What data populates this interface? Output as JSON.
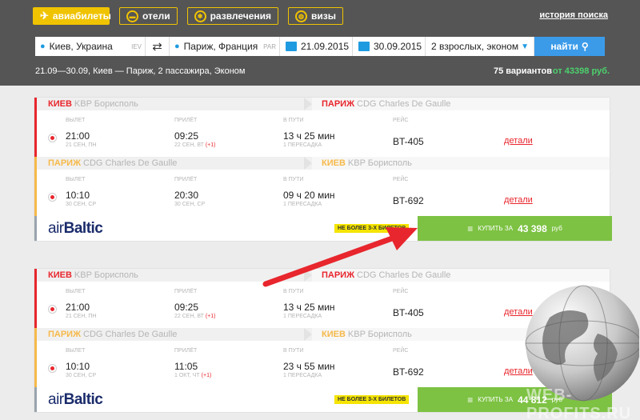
{
  "nav": {
    "flights": "авиабилеты",
    "hotels": "отели",
    "fun": "развлечения",
    "visas": "визы",
    "history": "история поиска"
  },
  "search": {
    "from": "Киев, Украина",
    "from_code": "IEV",
    "to": "Париж, Франция",
    "to_code": "PAR",
    "date_out": "21.09.2015",
    "date_back": "30.09.2015",
    "passengers": "2 взрослых, эконом",
    "find": "найти"
  },
  "summary": {
    "text": "21.09—30.09, Киев — Париж, 2 пассажира, Эконом",
    "variants": "75 вариантов",
    "from_price": "от 43398 руб."
  },
  "labels": {
    "depart": "вылет",
    "arrive": "прилёт",
    "in_way": "в пути",
    "flight": "рейс",
    "details": "детали",
    "limit": "НЕ БОЛЕЕ 3-Х БИЛЕТОВ",
    "buy_for": "купить за",
    "currency": "руб"
  },
  "results": [
    {
      "out": {
        "from_city": "КИЕВ",
        "from_airport": "KBP Борисполь",
        "to_city": "ПАРИЖ",
        "to_airport": "CDG Charles De Gaulle",
        "dep_time": "21:00",
        "dep_date": "21 СЕН, ПН",
        "arr_time": "09:25",
        "arr_date": "22 СЕН, ВТ",
        "arr_plus": "(+1)",
        "duration": "13 ч 25 мин",
        "stops": "1 ПЕРЕСАДКА",
        "flight": "BT-405"
      },
      "back": {
        "from_city": "ПАРИЖ",
        "from_airport": "CDG Charles De Gaulle",
        "to_city": "КИЕВ",
        "to_airport": "KBP Борисполь",
        "dep_time": "10:10",
        "dep_date": "30 СЕН, СР",
        "arr_time": "20:30",
        "arr_date": "30 СЕН, СР",
        "arr_plus": "",
        "duration": "09 ч 20 мин",
        "stops": "1 ПЕРЕСАДКА",
        "flight": "BT-692"
      },
      "airline_a": "air",
      "airline_b": "Baltic",
      "price": "43 398"
    },
    {
      "out": {
        "from_city": "КИЕВ",
        "from_airport": "KBP Борисполь",
        "to_city": "ПАРИЖ",
        "to_airport": "CDG Charles De Gaulle",
        "dep_time": "21:00",
        "dep_date": "21 СЕН, ПН",
        "arr_time": "09:25",
        "arr_date": "22 СЕН, ВТ",
        "arr_plus": "(+1)",
        "duration": "13 ч 25 мин",
        "stops": "1 ПЕРЕСАДКА",
        "flight": "BT-405"
      },
      "back": {
        "from_city": "ПАРИЖ",
        "from_airport": "CDG Charles De Gaulle",
        "to_city": "КИЕВ",
        "to_airport": "KBP Борисполь",
        "dep_time": "10:10",
        "dep_date": "30 СЕН, СР",
        "arr_time": "11:05",
        "arr_date": "1 ОКТ, ЧТ",
        "arr_plus": "(+1)",
        "duration": "23 ч 55 мин",
        "stops": "1 ПЕРЕСАДКА",
        "flight": "BT-692"
      },
      "airline_a": "air",
      "airline_b": "Baltic",
      "price": "44 812"
    }
  ],
  "watermark": "WEB-PROFITS.RU",
  "colors": {
    "accent": "#f0c300",
    "red": "#e8262d",
    "green": "#7dc243",
    "blue": "#3b9be9"
  }
}
